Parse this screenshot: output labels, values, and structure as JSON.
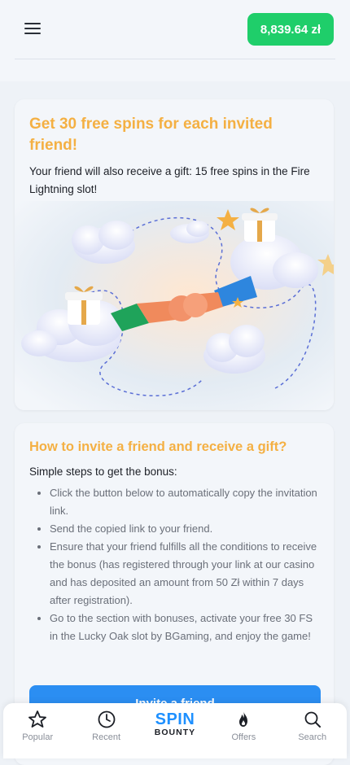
{
  "header": {
    "menu_icon": "hamburger-menu-icon",
    "balance": "8,839.64 zł",
    "balance_color": "#1fce6a"
  },
  "promo": {
    "title": "Get 30 free spins for each invited friend!",
    "subtitle": "Your friend will also receive a gift: 15 free spins in the Fire Lightning slot!",
    "accent_color": "#f4b043"
  },
  "howto": {
    "title": "How to invite a friend and receive a gift?",
    "steps_heading": "Simple steps to get the bonus:",
    "steps": [
      "Click the button below to automatically copy the invitation link.",
      "Send the copied link to your friend.",
      "Ensure that your friend fulfills all the conditions to receive the bonus (has registered through your link at our casino and has deposited an amount from 50 Zł within 7 days after registration).",
      "Go to the section with bonuses, activate your free 30 FS in the Lucky Oak slot by BGaming, and enjoy the game!"
    ],
    "button_label": "Invite a friend",
    "button_color": "#2b8ef2"
  },
  "nav": {
    "items": [
      {
        "label": "Popular",
        "icon": "star-icon"
      },
      {
        "label": "Recent",
        "icon": "clock-icon"
      },
      {
        "label": "",
        "icon": "logo"
      },
      {
        "label": "Offers",
        "icon": "fire-icon"
      },
      {
        "label": "Search",
        "icon": "search-icon"
      }
    ],
    "logo_top": "SPIN",
    "logo_bottom": "BOUNTY"
  }
}
